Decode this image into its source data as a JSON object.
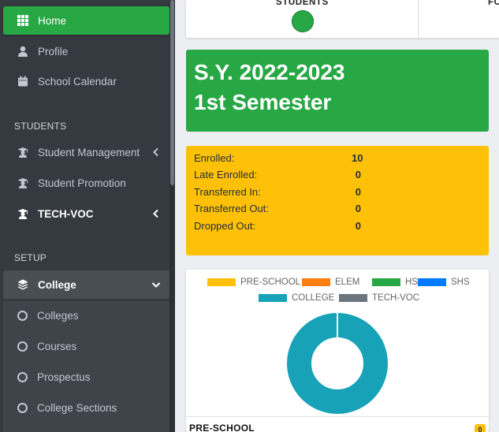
{
  "sidebar": {
    "items": [
      {
        "label": "Home",
        "icon": "grid-icon"
      },
      {
        "label": "Profile",
        "icon": "user-icon"
      },
      {
        "label": "School Calendar",
        "icon": "calendar-icon"
      }
    ],
    "section_students": "STUDENTS",
    "student_items": [
      {
        "label": "Student Management",
        "icon": "graduate-icon"
      },
      {
        "label": "Student Promotion",
        "icon": "graduate-icon"
      },
      {
        "label": "TECH-VOC",
        "icon": "graduate-icon"
      }
    ],
    "section_setup": "SETUP",
    "setup_item": {
      "label": "College",
      "icon": "layers-icon"
    },
    "sub_items": [
      {
        "label": "Colleges"
      },
      {
        "label": "Courses"
      },
      {
        "label": "Prospectus"
      },
      {
        "label": "College Sections"
      }
    ]
  },
  "top": {
    "students_label": "STUDENTS",
    "next_label": "FC"
  },
  "school_year": {
    "line1": "S.Y. 2022-2023",
    "line2": "1st Semester"
  },
  "stats": [
    {
      "label": "Enrolled:",
      "value": "10"
    },
    {
      "label": "Late Enrolled:",
      "value": "0"
    },
    {
      "label": "Transferred In:",
      "value": "0"
    },
    {
      "label": "Transferred Out:",
      "value": "0"
    },
    {
      "label": "Dropped Out:",
      "value": "0"
    }
  ],
  "chart_data": {
    "type": "pie",
    "categories": [
      "PRE-SCHOOL",
      "ELEM",
      "HS",
      "SHS",
      "COLLEGE",
      "TECH-VOC"
    ],
    "values": [
      0,
      0,
      0,
      0,
      10,
      0
    ],
    "colors": [
      "#ffc107",
      "#fd7e14",
      "#28a745",
      "#007bff",
      "#17a2b8",
      "#6c757d"
    ],
    "legend": "top"
  },
  "footer": {
    "label": "PRE-SCHOOL",
    "badge": "0"
  },
  "colors": {
    "sidebar_bg": "#343a40",
    "active": "#28a745",
    "warning": "#ffc107"
  }
}
